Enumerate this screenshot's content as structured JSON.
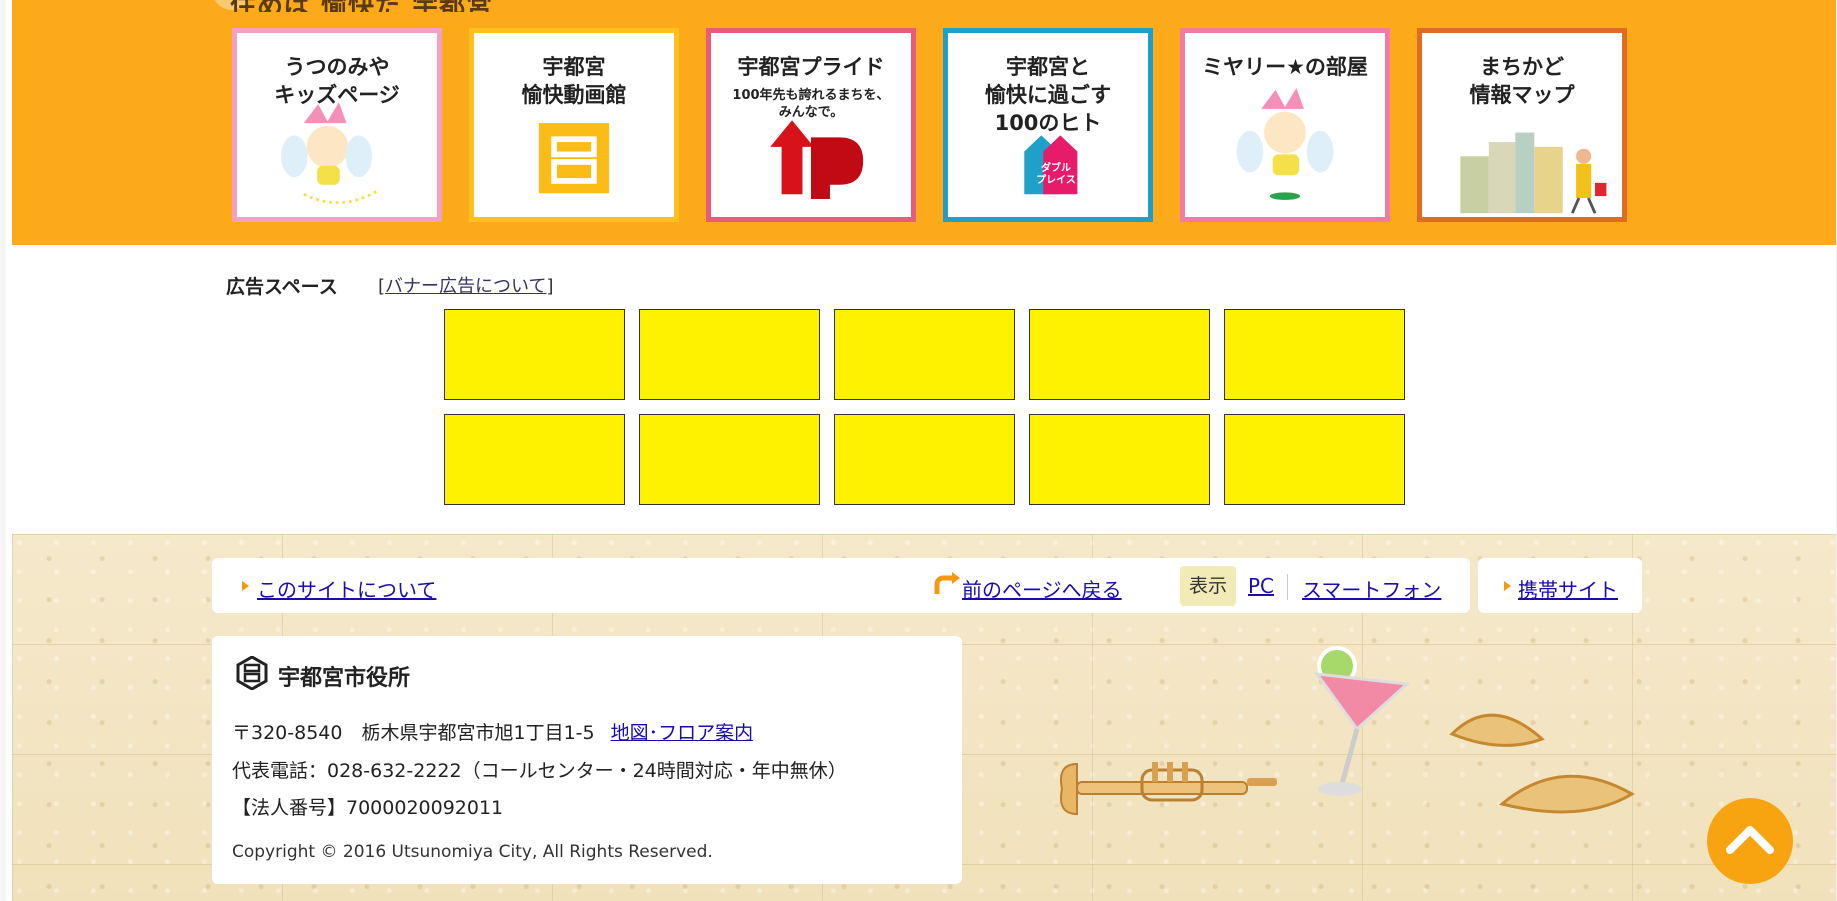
{
  "band": {
    "heading": "住めば 愉快だ 宇都宮"
  },
  "banners": [
    {
      "title": "うつのみや\nキッズページ",
      "sub": "",
      "border": "#f3a0c4",
      "icon": "mascot-icon"
    },
    {
      "title": "宇都宮\n愉快動画館",
      "sub": "",
      "border": "#fcc11c",
      "icon": "miya-logo-icon"
    },
    {
      "title": "宇都宮プライド",
      "sub": "100年先も誇れるまちを、\nみんなで。",
      "border": "#e75b7b",
      "icon": "pride-up-icon"
    },
    {
      "title": "宇都宮と\n愉快に過ごす\n100のヒト",
      "sub": "",
      "border": "#1ea0c8",
      "icon": "double-place-icon"
    },
    {
      "title": "ミヤリー★の部屋",
      "sub": "",
      "border": "#f07aa8",
      "icon": "miyari-mascot-icon"
    },
    {
      "title": "まちかど\n情報マップ",
      "sub": "",
      "border": "#e06b24",
      "icon": "city-map-icon"
    }
  ],
  "double_place_label": "ダブル\nプレイス",
  "ads": {
    "label": "広告スペース",
    "link_prefix": "[",
    "link_text": "バナー広告について",
    "link_suffix": "]",
    "slot_color": "#fff200",
    "slot_count": 10
  },
  "footer": {
    "nav": {
      "about": "このサイトについて",
      "back": "前のページへ戻る",
      "display": "表示",
      "pc": "PC",
      "smartphone": "スマートフォン",
      "mobile": "携帯サイト"
    },
    "org": "宇都宮市役所",
    "address": "〒320-8540　栃木県宇都宮市旭1丁目1-5",
    "map_link": "地図･フロア案内",
    "phone": "代表電話：028-632-2222（コールセンター・24時間対応・年中無休）",
    "corp_number": "【法人番号】7000020092011",
    "copyright": "Copyright © 2016 Utsunomiya City, All Rights Reserved."
  },
  "colors": {
    "band": "#fcaa19",
    "accent": "#f7a410",
    "link": "#1a0dab"
  }
}
